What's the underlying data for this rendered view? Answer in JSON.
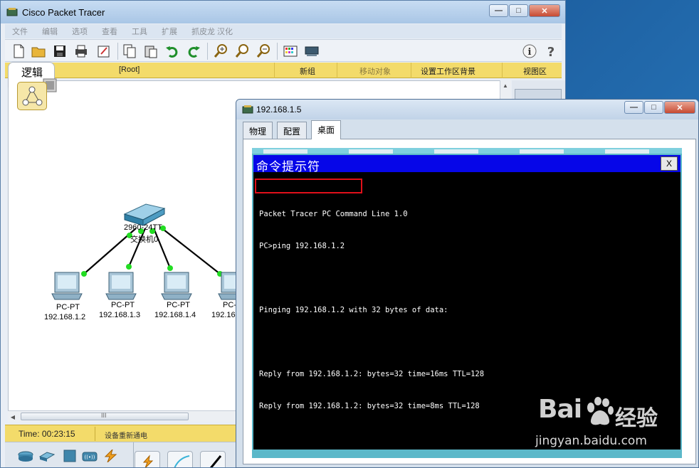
{
  "main_window": {
    "title": "Cisco Packet Tracer",
    "menu": [
      "文件",
      "编辑",
      "选项",
      "查看",
      "工具",
      "扩展",
      "抓皮龙 汉化"
    ],
    "toolbar_icons": [
      "new-icon",
      "open-icon",
      "save-icon",
      "print-icon",
      "activity-wizard-icon",
      "copy-icon",
      "paste-icon",
      "undo-icon",
      "redo-icon",
      "zoom-in-icon",
      "zoom-reset-icon",
      "zoom-out-icon",
      "palette-icon",
      "custom-device-icon",
      "info-icon",
      "help-icon"
    ],
    "logical_tab": "逻辑",
    "yellowbar": {
      "root": "[Root]",
      "new_cluster": "新组",
      "move_object": "移动对象",
      "set_background": "设置工作区背景",
      "viewport": "视图区"
    },
    "status": {
      "time": "Time: 00:23:15",
      "message": "设备重新通电"
    },
    "scroll_arrow_glyph": "III"
  },
  "network": {
    "switch": {
      "name_line1": "2960-24TT",
      "name_line2": "交换机0"
    },
    "pcs": [
      {
        "type": "PC-PT",
        "ip": "192.168.1.2"
      },
      {
        "type": "PC-PT",
        "ip": "192.168.1.3"
      },
      {
        "type": "PC-PT",
        "ip": "192.168.1.4"
      },
      {
        "type": "PC-",
        "ip": "192.16"
      }
    ],
    "link_color": "#000000",
    "port_color": "#22dd22"
  },
  "pc_window": {
    "title": "192.168.1.5",
    "tabs": [
      "物理",
      "配置",
      "桌面"
    ],
    "active_tab": "桌面",
    "command_prompt": {
      "title": "命令提示符",
      "close_label": "X",
      "lines": [
        "Packet Tracer PC Command Line 1.0",
        "PC>ping 192.168.1.2",
        "",
        "Pinging 192.168.1.2 with 32 bytes of data:",
        "",
        "Reply from 192.168.1.2: bytes=32 time=16ms TTL=128",
        "Reply from 192.168.1.2: bytes=32 time=8ms TTL=128"
      ]
    }
  },
  "watermark": {
    "brand": "Bai",
    "brand_cn": "经验",
    "url": "jingyan.baidu.com"
  },
  "colors": {
    "accent_yellow": "#f3db6a",
    "cmd_title_blue": "#0606e8",
    "highlight_red": "#e0101a",
    "desktop_teal": "#5bb8c9"
  }
}
